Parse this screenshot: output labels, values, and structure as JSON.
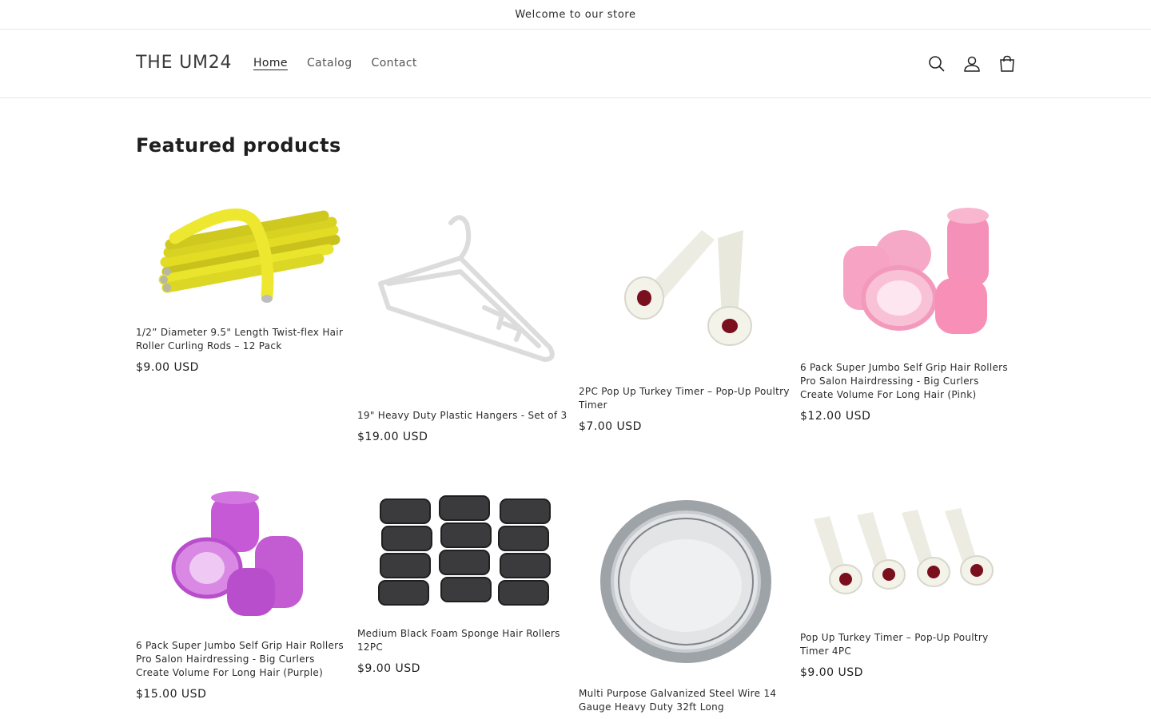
{
  "announcement": {
    "text": "Welcome to our store"
  },
  "header": {
    "logo": "THE UM24",
    "nav": [
      "Home",
      "Catalog",
      "Contact"
    ],
    "icons": [
      "search-icon",
      "account-icon",
      "cart-icon"
    ]
  },
  "section": {
    "title": "Featured products"
  },
  "products": [
    {
      "title": "1/2” Diameter 9.5\" Length Twist-flex Hair Roller Curling Rods – 12 Pack",
      "price": "$9.00 USD",
      "image": "yellow-flex-rods"
    },
    {
      "title": "19\" Heavy Duty Plastic Hangers - Set of 3",
      "price": "$19.00 USD",
      "image": "white-hanger"
    },
    {
      "title": "2PC Pop Up Turkey Timer – Pop-Up Poultry Timer",
      "price": "$7.00 USD",
      "image": "turkey-timer-2pc"
    },
    {
      "title": "6 Pack Super Jumbo Self Grip Hair Rollers Pro Salon Hairdressing - Big Curlers Create Volume For Long Hair (Pink)",
      "price": "$12.00 USD",
      "image": "pink-rollers"
    },
    {
      "title": "6 Pack Super Jumbo Self Grip Hair Rollers Pro Salon Hairdressing - Big Curlers Create Volume For Long Hair (Purple)",
      "price": "$15.00 USD",
      "image": "purple-rollers"
    },
    {
      "title": "Medium Black Foam Sponge Hair Rollers 12PC",
      "price": "$9.00 USD",
      "image": "black-foam-rollers"
    },
    {
      "title": "Multi Purpose Galvanized Steel Wire 14 Gauge Heavy Duty 32ft Long",
      "price": "",
      "image": "steel-wire-coil"
    },
    {
      "title": "Pop Up Turkey Timer – Pop-Up Poultry Timer 4PC",
      "price": "$9.00 USD",
      "image": "turkey-timer-4pc"
    }
  ]
}
